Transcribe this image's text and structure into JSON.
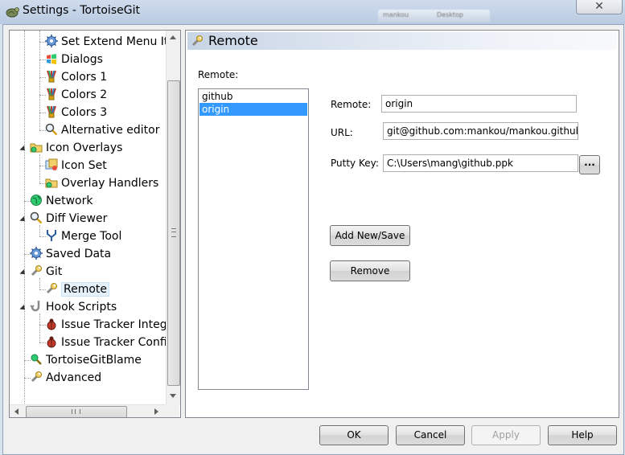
{
  "window": {
    "title": "Settings - TortoiseGit",
    "close_symbol": "✕",
    "background_tabs": [
      "mankou",
      "Desktop"
    ]
  },
  "tree": {
    "items": [
      {
        "label": "Set Extend Menu Ite",
        "icon": "gear-icon"
      },
      {
        "label": "Dialogs",
        "icon": "windows-flag-icon"
      },
      {
        "label": "Colors 1",
        "icon": "color-brush-icon"
      },
      {
        "label": "Colors 2",
        "icon": "color-brush-icon"
      },
      {
        "label": "Colors 3",
        "icon": "color-brush-icon"
      },
      {
        "label": "Alternative editor",
        "icon": "magnifier-icon"
      },
      {
        "label": "Icon Overlays",
        "icon": "folder-overlay-icon"
      },
      {
        "label": "Icon Set",
        "icon": "icon-set-icon"
      },
      {
        "label": "Overlay Handlers",
        "icon": "folder-overlay-icon"
      },
      {
        "label": "Network",
        "icon": "globe-icon"
      },
      {
        "label": "Diff Viewer",
        "icon": "magnifier-icon"
      },
      {
        "label": "Merge Tool",
        "icon": "merge-icon"
      },
      {
        "label": "Saved Data",
        "icon": "gear-icon"
      },
      {
        "label": "Git",
        "icon": "wrench-icon"
      },
      {
        "label": "Remote",
        "icon": "wrench-icon"
      },
      {
        "label": "Hook Scripts",
        "icon": "hook-icon"
      },
      {
        "label": "Issue Tracker Integr",
        "icon": "bug-icon"
      },
      {
        "label": "Issue Tracker Config",
        "icon": "bug-icon"
      },
      {
        "label": "TortoiseGitBlame",
        "icon": "blame-icon"
      },
      {
        "label": "Advanced",
        "icon": "wrench-icon"
      }
    ]
  },
  "page": {
    "title": "Remote",
    "remote_list_label": "Remote:",
    "remotes": [
      "github",
      "origin"
    ],
    "selected_remote": "origin",
    "remote_label": "Remote:",
    "remote_value": "origin",
    "url_label": "URL:",
    "url_value": "git@github.com:mankou/mankou.github.c",
    "putty_label": "Putty Key:",
    "putty_value": "C:\\Users\\mang\\github.ppk",
    "browse_label": "...",
    "add_label": "Add New/Save",
    "remove_label": "Remove"
  },
  "buttons": {
    "ok": "OK",
    "cancel": "Cancel",
    "apply": "Apply",
    "help": "Help"
  },
  "colors": {
    "selection": "#3399ff",
    "tree_selection": "#e5f1fb",
    "frame": "#d9e4f1"
  }
}
